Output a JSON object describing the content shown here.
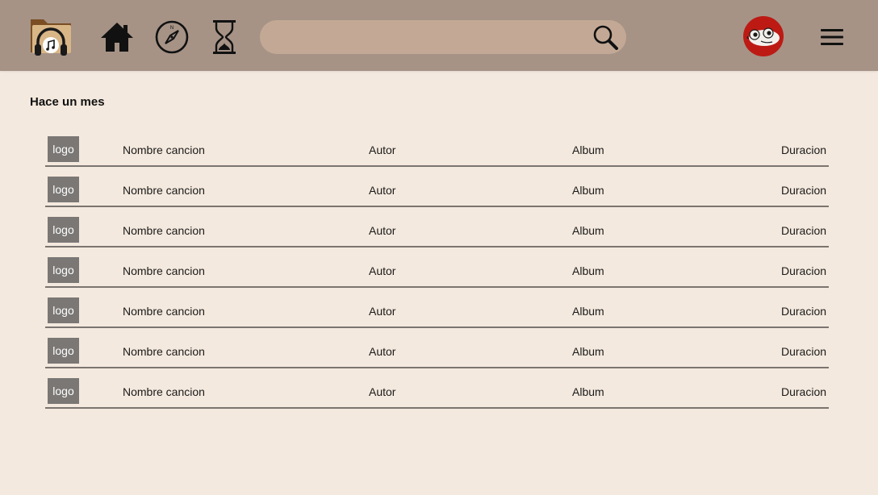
{
  "header": {
    "icons": [
      "music-folder-logo",
      "home-icon",
      "compass-icon",
      "hourglass-icon",
      "search-icon",
      "avatar",
      "hamburger-menu-icon"
    ],
    "search": {
      "value": "",
      "placeholder": ""
    },
    "colors": {
      "topbar": "#a69386",
      "search": "#c3a995",
      "avatar": "#bd1a14",
      "background": "#f4e9de"
    }
  },
  "section": {
    "title": "Hace un mes"
  },
  "songs": [
    {
      "logo": "logo",
      "name": "Nombre cancion",
      "author": "Autor",
      "album": "Album",
      "duration": "Duracion"
    },
    {
      "logo": "logo",
      "name": "Nombre cancion",
      "author": "Autor",
      "album": "Album",
      "duration": "Duracion"
    },
    {
      "logo": "logo",
      "name": "Nombre cancion",
      "author": "Autor",
      "album": "Album",
      "duration": "Duracion"
    },
    {
      "logo": "logo",
      "name": "Nombre cancion",
      "author": "Autor",
      "album": "Album",
      "duration": "Duracion"
    },
    {
      "logo": "logo",
      "name": "Nombre cancion",
      "author": "Autor",
      "album": "Album",
      "duration": "Duracion"
    },
    {
      "logo": "logo",
      "name": "Nombre cancion",
      "author": "Autor",
      "album": "Album",
      "duration": "Duracion"
    },
    {
      "logo": "logo",
      "name": "Nombre cancion",
      "author": "Autor",
      "album": "Album",
      "duration": "Duracion"
    }
  ]
}
